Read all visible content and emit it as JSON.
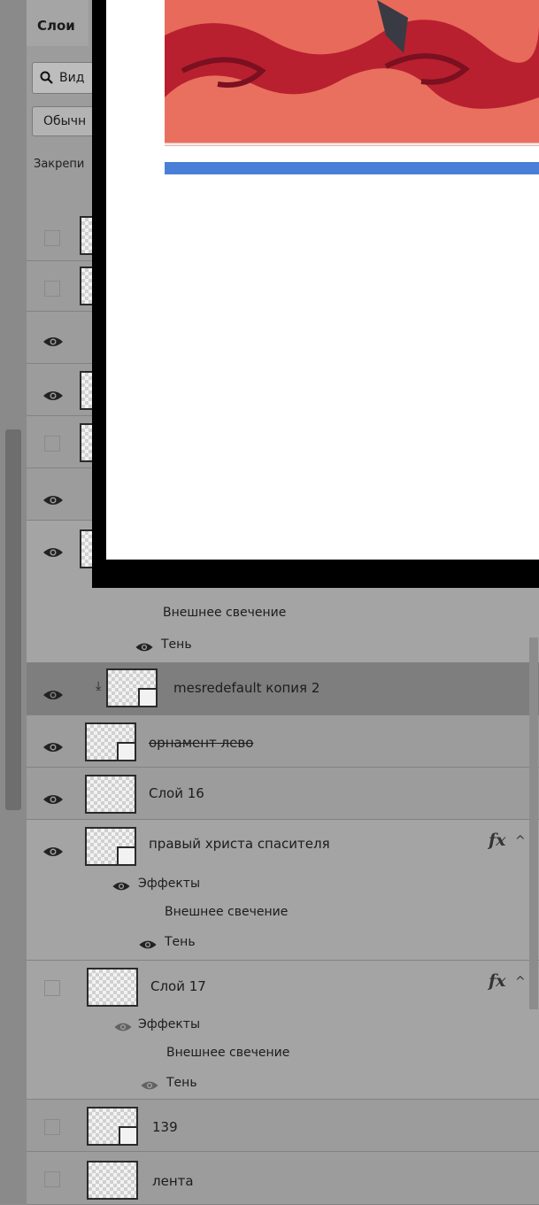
{
  "panel": {
    "tab_label": "Слои",
    "search_label": "Вид",
    "blend_mode": "Обычн",
    "lock_label": "Закрепи"
  },
  "colors": {
    "panel_bg": "#9c9c9c",
    "selected_row": "#7e7e7e",
    "canvas_frame": "#000000",
    "artwork_red": "#c2263a",
    "artwork_blue_bar": "#4a7fd8"
  },
  "layers_top": {
    "fx_1": "Внешнее свечение",
    "fx_2": "Тень"
  },
  "layers": [
    {
      "name": "mesredefault копия 2",
      "visible": true,
      "smart": true,
      "selected": true
    },
    {
      "name": "орнамент лево",
      "visible": true,
      "smart": true
    },
    {
      "name": "Слой 16",
      "visible": true,
      "smart": false
    },
    {
      "name": "правый христа спасителя",
      "visible": true,
      "smart": true,
      "fx": "fx",
      "effects_label": "Эффекты",
      "effects": [
        "Внешнее свечение",
        "Тень"
      ]
    },
    {
      "name": "Слой 17",
      "visible": false,
      "smart": false,
      "fx": "fx",
      "effects_label": "Эффекты",
      "effects": [
        "Внешнее свечение",
        "Тень"
      ]
    },
    {
      "name": "139",
      "visible": false,
      "smart": true
    },
    {
      "name": "лента",
      "visible": false,
      "smart": false
    }
  ]
}
